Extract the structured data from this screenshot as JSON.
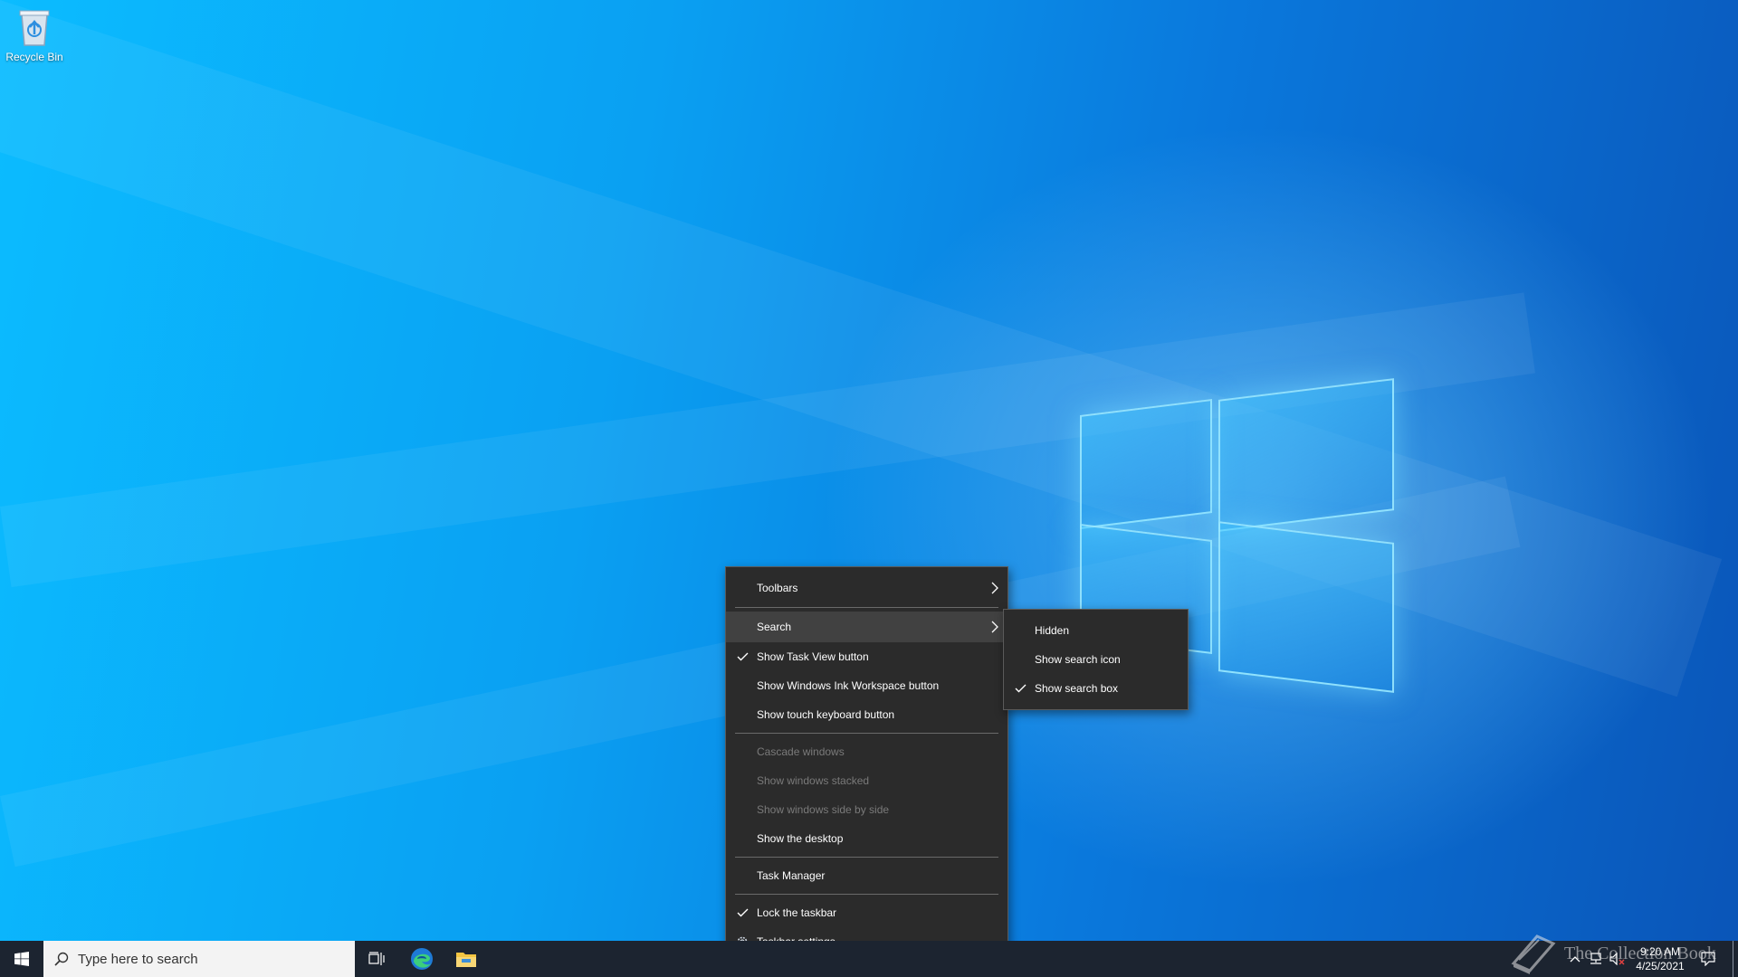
{
  "desktop": {
    "icons": [
      {
        "label": "Recycle Bin",
        "icon": "recycle-bin-icon"
      }
    ]
  },
  "taskbar": {
    "start_icon": "windows-logo-icon",
    "search_placeholder": "Type here to search",
    "pinned": [
      {
        "name": "task-view-icon"
      },
      {
        "name": "edge-icon"
      },
      {
        "name": "file-explorer-icon"
      }
    ],
    "clock": {
      "time": "9:20 AM",
      "date": "4/25/2021"
    },
    "watermark": "The Collection Book"
  },
  "context_menu": {
    "items": [
      {
        "label": "Toolbars",
        "submenu": true
      },
      {
        "label": "Search",
        "submenu": true,
        "highlighted": true
      },
      {
        "label": "Show Task View button",
        "checked": true
      },
      {
        "label": "Show Windows Ink Workspace button"
      },
      {
        "label": "Show touch keyboard button"
      },
      {
        "label": "Cascade windows",
        "disabled": true
      },
      {
        "label": "Show windows stacked",
        "disabled": true
      },
      {
        "label": "Show windows side by side",
        "disabled": true
      },
      {
        "label": "Show the desktop"
      },
      {
        "label": "Task Manager"
      },
      {
        "label": "Lock the taskbar",
        "checked": true
      },
      {
        "label": "Taskbar settings",
        "icon": "gear-icon"
      }
    ]
  },
  "search_submenu": {
    "items": [
      {
        "label": "Hidden"
      },
      {
        "label": "Show search icon"
      },
      {
        "label": "Show search box",
        "checked": true
      }
    ]
  },
  "colors": {
    "menu_bg": "#2b2b2b",
    "menu_highlight": "#414141",
    "taskbar_bg": "#1c2430",
    "wallpaper_accent": "#0a78dc"
  }
}
